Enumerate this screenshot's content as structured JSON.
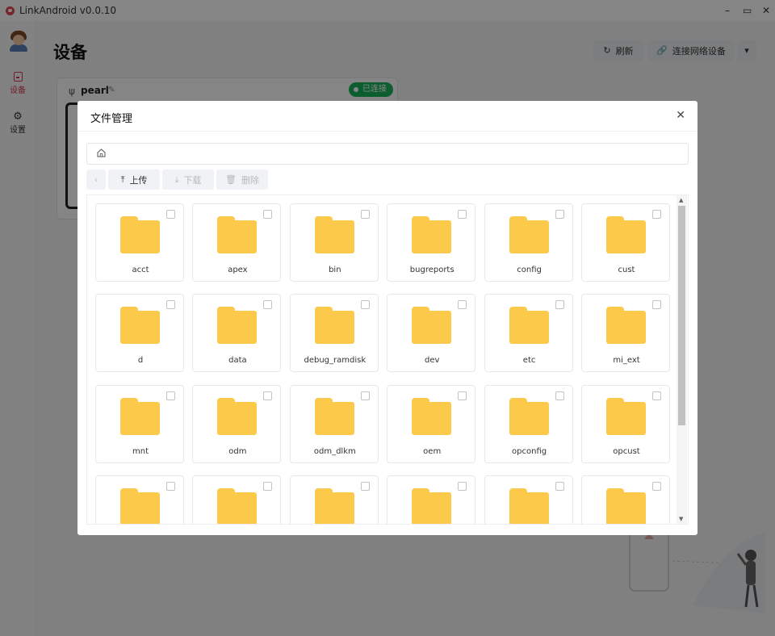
{
  "window": {
    "title": "LinkAndroid v0.0.10",
    "minimize": "–",
    "maximize": "▭",
    "close": "✕"
  },
  "sidebar": {
    "items": [
      {
        "label": "设备",
        "icon": "device-icon",
        "active": true
      },
      {
        "label": "设置",
        "icon": "gear-icon",
        "active": false
      }
    ]
  },
  "main": {
    "title": "设备",
    "actions": {
      "refresh": "刷新",
      "connect_network": "连接网络设备"
    }
  },
  "device": {
    "name": "pearl",
    "status": "已连接",
    "status_color": "#19b55b"
  },
  "modal": {
    "title": "文件管理",
    "path": "",
    "toolbar": {
      "upload": "上传",
      "download": "下载",
      "delete": "删除"
    },
    "files": [
      "acct",
      "apex",
      "bin",
      "bugreports",
      "config",
      "cust",
      "d",
      "data",
      "debug_ramdisk",
      "dev",
      "etc",
      "mi_ext",
      "mnt",
      "odm",
      "odm_dlkm",
      "oem",
      "opconfig",
      "opcust",
      "",
      "",
      "",
      "",
      "",
      ""
    ]
  },
  "colors": {
    "accent": "#d63a56",
    "folder": "#fcc94a"
  }
}
